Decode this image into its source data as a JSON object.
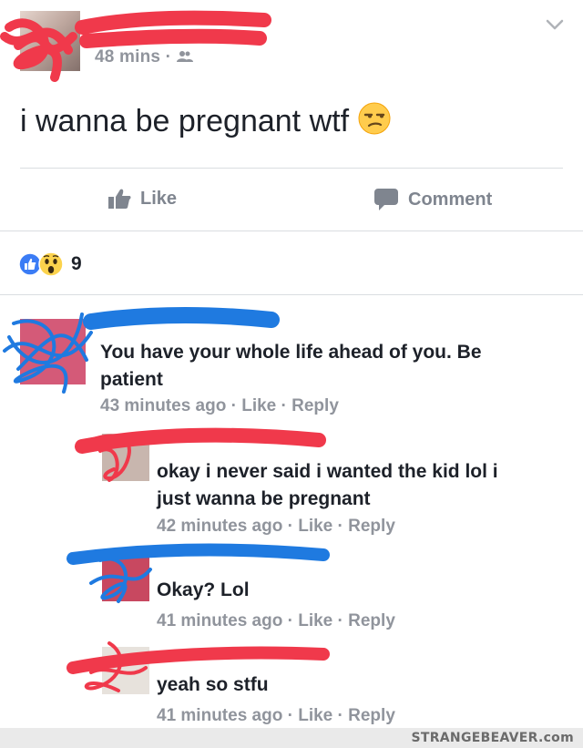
{
  "post": {
    "meta": "48 mins · ",
    "text": "i wanna be pregnant wtf",
    "emoji": "unamused-face"
  },
  "actions": {
    "like": "Like",
    "comment": "Comment"
  },
  "reactions": {
    "count": "9",
    "icons": [
      "like-icon",
      "wow-icon"
    ]
  },
  "comments": [
    {
      "text_line1": "You have your whole life ahead of you. Be",
      "text_line2": "patient",
      "time": "43 minutes ago",
      "like": "Like",
      "reply": "Reply"
    },
    {
      "text_line1": "okay i never said i wanted the kid lol i",
      "text_line2": "just wanna be pregnant",
      "time": "42 minutes ago",
      "like": "Like",
      "reply": "Reply"
    },
    {
      "text_line1": "Okay? Lol",
      "time": "41 minutes ago",
      "like": "Like",
      "reply": "Reply"
    },
    {
      "text_line1": "yeah so stfu",
      "time": "41 minutes ago",
      "like": "Like",
      "reply": "Reply"
    }
  ],
  "separator": " · ",
  "watermark": "STRANGEBEAVER.com",
  "colors": {
    "redaction_red": "#f0394b",
    "redaction_blue": "#1f7ae0",
    "meta_gray": "#90949c"
  }
}
